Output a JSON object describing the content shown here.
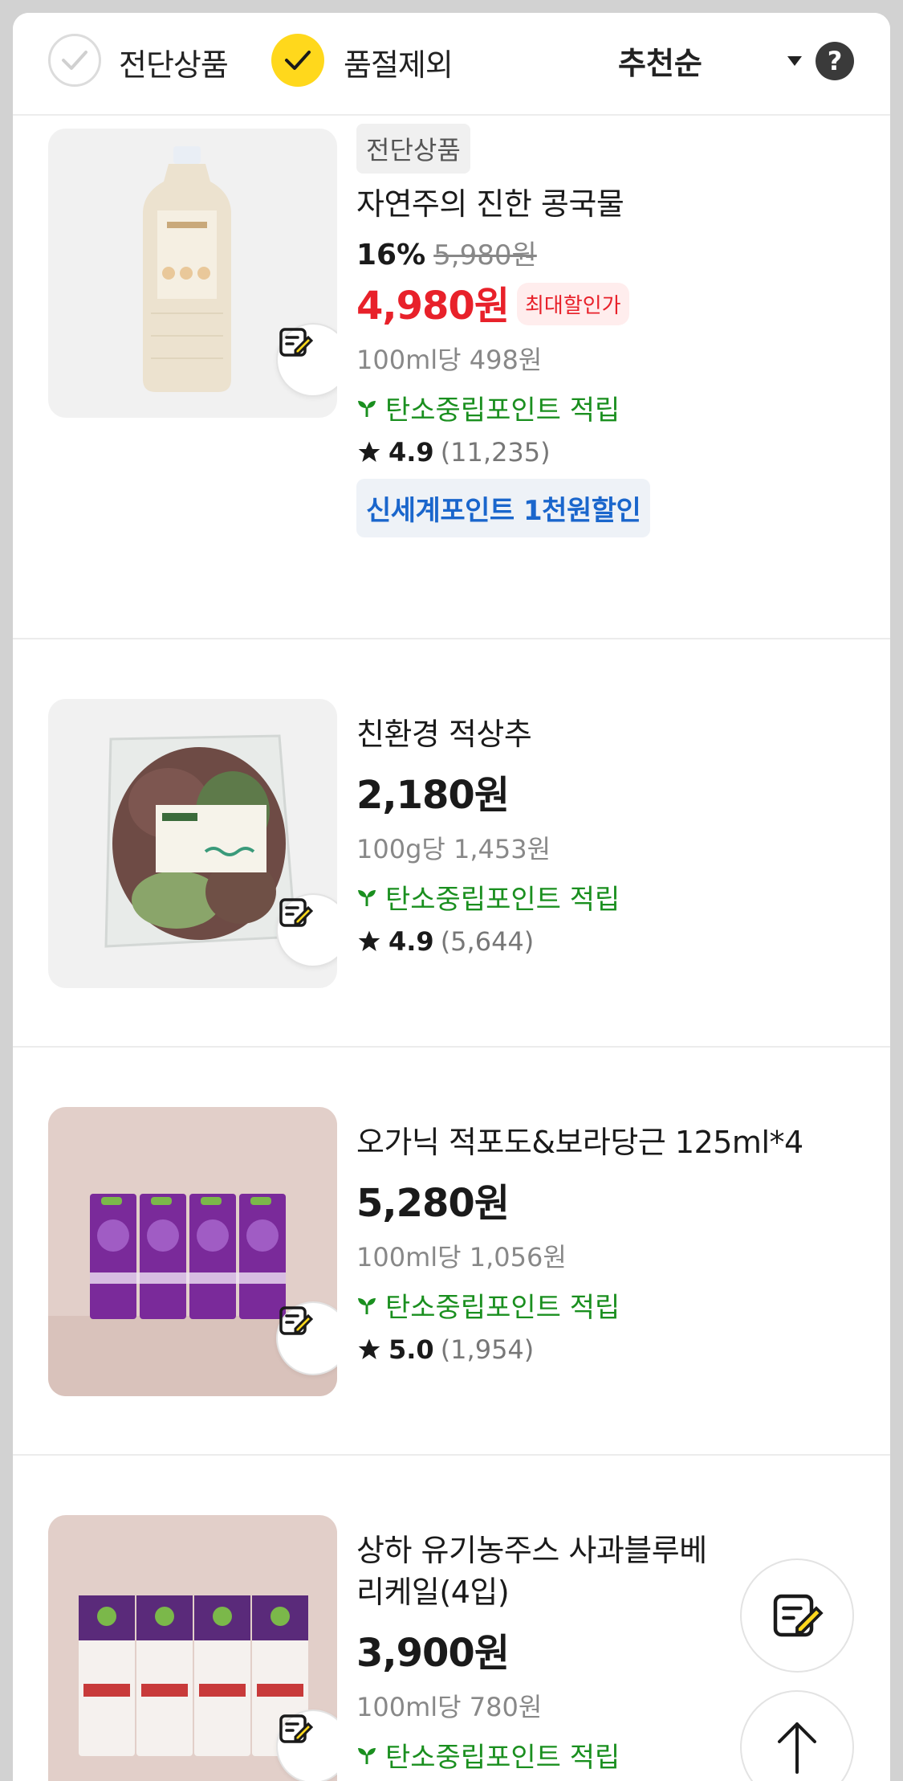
{
  "filters": {
    "items": [
      {
        "label": "전단상품",
        "checked": false
      },
      {
        "label": "품절제외",
        "checked": true
      }
    ],
    "sort_label": "추천순",
    "help_label": "?"
  },
  "products": [
    {
      "badge": "전단상품",
      "name": "자연주의 진한 콩국물",
      "discount": "16%",
      "original_price": "5,980원",
      "price": "4,980원",
      "price_tag": "최대할인가",
      "unit_price": "100ml당 498원",
      "eco": "탄소중립포인트 적립",
      "rating": "4.9",
      "reviews": "(11,235)",
      "promo": "신세계포인트 1천원할인"
    },
    {
      "name": "친환경 적상추",
      "price": "2,180원",
      "unit_price": "100g당 1,453원",
      "eco": "탄소중립포인트 적립",
      "rating": "4.9",
      "reviews": "(5,644)"
    },
    {
      "name": "오가닉 적포도&보라당근 125ml*4",
      "price": "5,280원",
      "unit_price": "100ml당 1,056원",
      "eco": "탄소중립포인트 적립",
      "rating": "5.0",
      "reviews": "(1,954)"
    },
    {
      "name": "상하 유기농주스 사과블루베리케일(4입)",
      "price": "3,900원",
      "unit_price": "100ml당 780원",
      "eco": "탄소중립포인트 적립"
    }
  ],
  "colors": {
    "accent_yellow": "#ffd81c",
    "sale_red": "#e8212a",
    "eco_green": "#1a8f1f",
    "promo_blue": "#1a66cc"
  },
  "icons": [
    "check-icon",
    "caret-down-icon",
    "help-icon",
    "cart-memo-icon",
    "leaf-icon",
    "star-icon",
    "arrow-up-icon"
  ]
}
